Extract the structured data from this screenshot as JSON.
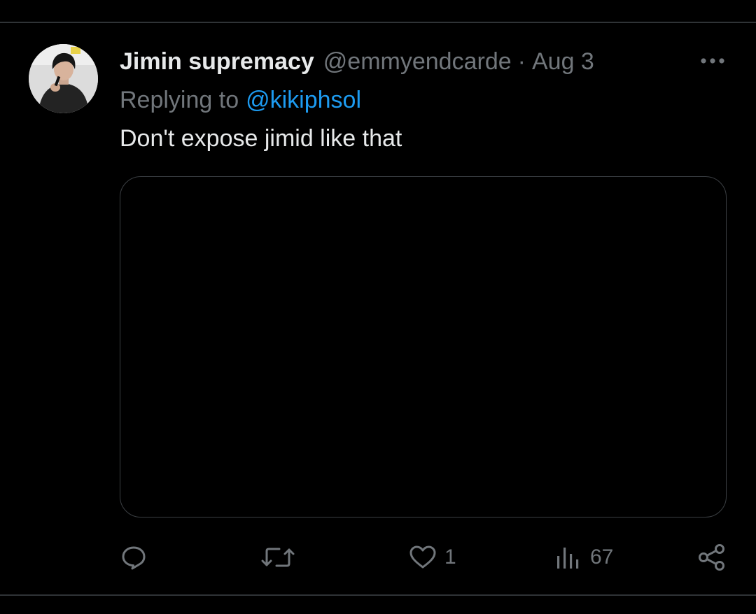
{
  "tweet": {
    "display_name": "Jimin supremacy",
    "handle": "@emmyendcarde",
    "separator": "·",
    "date": "Aug 3",
    "replying_prefix": "Replying to",
    "replying_handle": "@kikiphsol",
    "text": "Don't expose jimid like that"
  },
  "actions": {
    "reply_icon": "reply-bubble-icon",
    "retweet_icon": "retweet-icon",
    "like_icon": "heart-icon",
    "like_count": "1",
    "views_icon": "views-bars-icon",
    "views_count": "67",
    "share_icon": "share-icon",
    "more_icon": "more-dots-icon"
  },
  "colors": {
    "background": "#000000",
    "text": "#e7e9ea",
    "muted": "#71767b",
    "link": "#1d9bf0",
    "border": "#2f3336"
  }
}
